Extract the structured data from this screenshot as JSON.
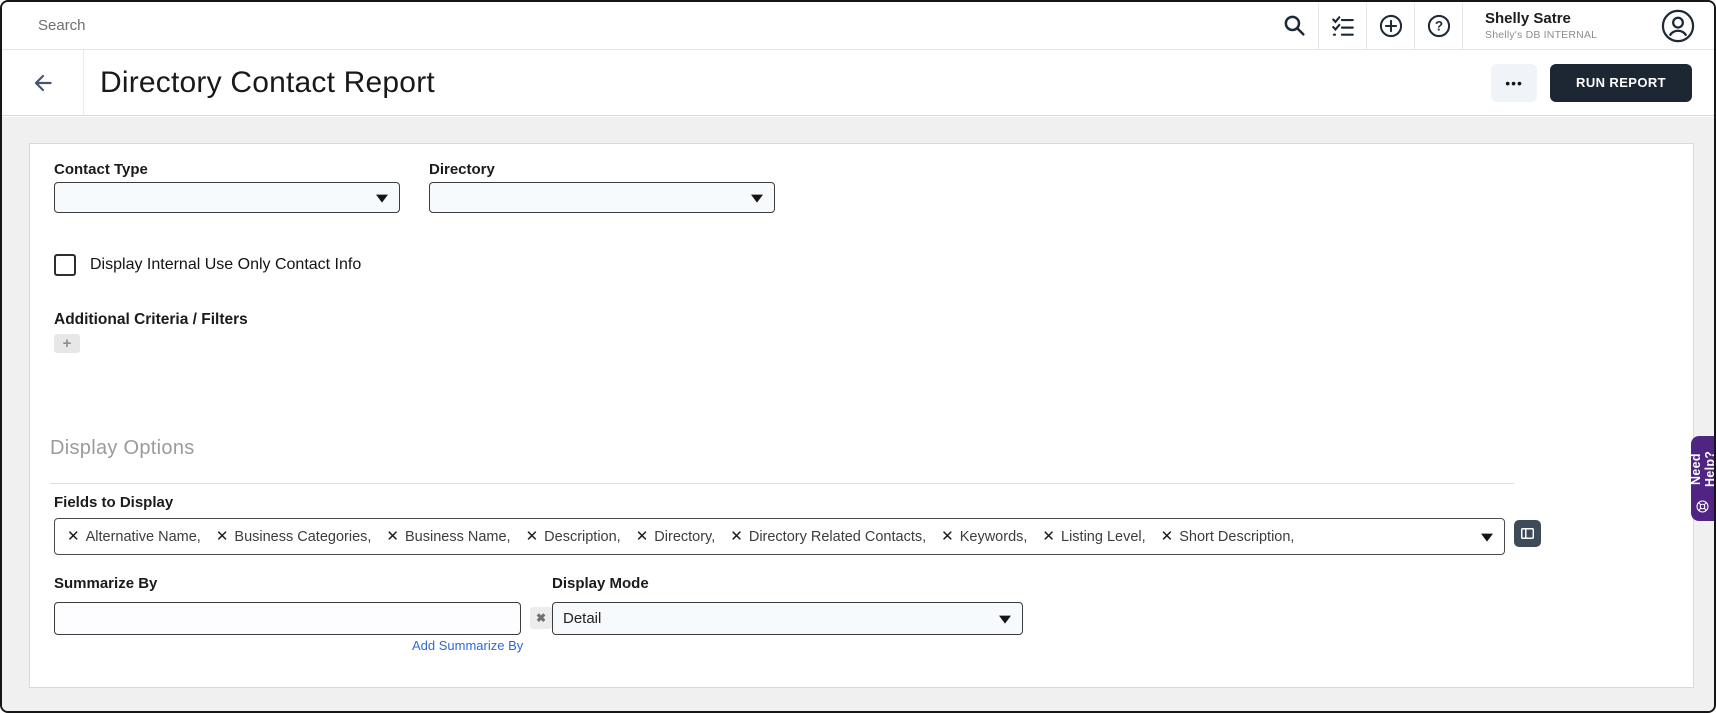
{
  "topbar": {
    "search_placeholder": "Search",
    "user_name": "Shelly Satre",
    "user_org": "Shelly's DB INTERNAL"
  },
  "header": {
    "title": "Directory Contact Report",
    "more_label": "•••",
    "run_report_label": "RUN REPORT"
  },
  "form": {
    "contact_type_label": "Contact Type",
    "contact_type_value": "",
    "directory_label": "Directory",
    "directory_value": "",
    "internal_info_label": "Display Internal Use Only Contact Info",
    "internal_info_checked": false,
    "additional_criteria_label": "Additional Criteria / Filters",
    "add_filter_glyph": "+"
  },
  "display_options": {
    "heading": "Display Options",
    "fields_to_display": {
      "label": "Fields to Display",
      "remove_glyph": "✕",
      "chips": [
        "Alternative Name",
        "Business Categories",
        "Business Name",
        "Description",
        "Directory",
        "Directory Related Contacts",
        "Keywords",
        "Listing Level",
        "Short Description"
      ]
    },
    "summarize_by": {
      "label": "Summarize By",
      "value": "",
      "clear_glyph": "✖",
      "add_link": "Add Summarize By"
    },
    "display_mode": {
      "label": "Display Mode",
      "value": "Detail"
    }
  },
  "help_tab": {
    "label": "Need Help?"
  },
  "colors": {
    "run_button_bg": "#1d2733",
    "help_tab_bg": "#4f2483",
    "link_blue": "#3069d6",
    "icon_dark": "#1f2a37",
    "page_bg": "#f0f0f1"
  }
}
